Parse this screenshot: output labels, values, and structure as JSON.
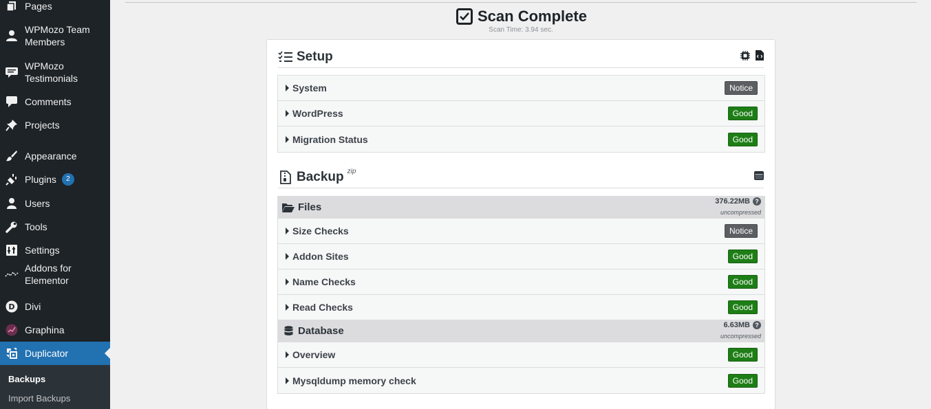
{
  "sidebar": {
    "items": [
      {
        "label": "Pages",
        "icon": "pages-icon"
      },
      {
        "label": "WPMozo Team Members",
        "icon": "team-members-icon"
      },
      {
        "label": "WPMozo Testimonials",
        "icon": "testimonials-icon"
      },
      {
        "label": "Comments",
        "icon": "comments-icon"
      },
      {
        "label": "Projects",
        "icon": "pin-icon"
      },
      {
        "label": "Appearance",
        "icon": "brush-icon"
      },
      {
        "label": "Plugins",
        "icon": "plugin-icon",
        "badge": "2"
      },
      {
        "label": "Users",
        "icon": "users-icon"
      },
      {
        "label": "Tools",
        "icon": "wrench-icon"
      },
      {
        "label": "Settings",
        "icon": "settings-icon"
      },
      {
        "label": "Addons for Elementor",
        "icon": "addons-icon"
      },
      {
        "label": "Divi",
        "icon": "divi-icon"
      },
      {
        "label": "Graphina",
        "icon": "graphina-icon"
      },
      {
        "label": "Duplicator",
        "icon": "duplicator-icon"
      }
    ],
    "submenu": [
      {
        "label": "Backups"
      },
      {
        "label": "Import Backups"
      }
    ]
  },
  "header": {
    "title": "Scan Complete",
    "scan_time": "Scan Time: 3.94 sec."
  },
  "setup": {
    "title": "Setup",
    "rows": [
      {
        "label": "System",
        "status": "Notice"
      },
      {
        "label": "WordPress",
        "status": "Good"
      },
      {
        "label": "Migration Status",
        "status": "Good"
      }
    ]
  },
  "backup": {
    "title": "Backup",
    "sup": "zip",
    "files": {
      "label": "Files",
      "size": "376.22MB",
      "size_note": "uncompressed",
      "rows": [
        {
          "label": "Size Checks",
          "status": "Notice"
        },
        {
          "label": "Addon Sites",
          "status": "Good"
        },
        {
          "label": "Name Checks",
          "status": "Good"
        },
        {
          "label": "Read Checks",
          "status": "Good"
        }
      ]
    },
    "database": {
      "label": "Database",
      "size": "6.63MB",
      "size_note": "uncompressed",
      "rows": [
        {
          "label": "Overview",
          "status": "Good"
        },
        {
          "label": "Mysqldump memory check",
          "status": "Good"
        }
      ]
    }
  },
  "colors": {
    "sidebar_bg": "#1d2327",
    "active": "#2271b1",
    "good": "#1e7e16",
    "notice": "#5c5f62"
  }
}
